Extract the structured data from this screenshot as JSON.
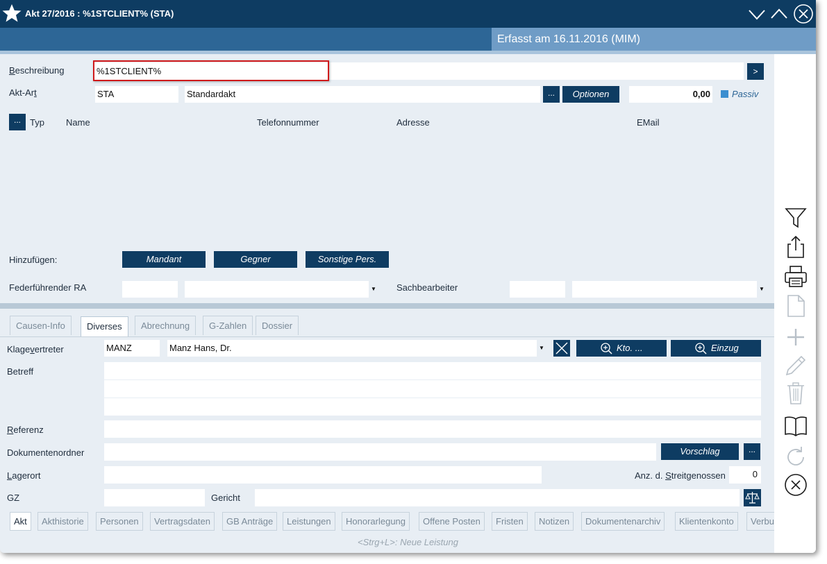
{
  "window": {
    "title": "Akt 27/2016 : %1STCLIENT% (STA)",
    "captured": "Erfasst am 16.11.2016 (MIM)"
  },
  "header_form": {
    "beschreibung_label": "Beschreibung",
    "beschreibung_value": "%1STCLIENT%",
    "expand_button": ">",
    "aktart_label": "Akt-Art",
    "aktart_code": "STA",
    "aktart_name": "Standardakt",
    "more_button": "...",
    "optionen_button": "Optionen",
    "amount": "0,00",
    "passiv_label": "Passiv"
  },
  "persons_table": {
    "menu_button": "...",
    "columns": [
      "Typ",
      "Name",
      "Telefonnummer",
      "Adresse",
      "EMail"
    ]
  },
  "add_row": {
    "label": "Hinzufügen:",
    "buttons": [
      "Mandant",
      "Gegner",
      "Sonstige Pers."
    ]
  },
  "responsible": {
    "ra_label": "Federführender RA",
    "sachbearbeiter_label": "Sachbearbeiter"
  },
  "tabs": [
    "Causen-Info",
    "Diverses",
    "Abrechnung",
    "G-Zahlen",
    "Dossier"
  ],
  "diverses": {
    "klagevertreter_label": "Klagevertreter",
    "klagevertreter_code": "MANZ",
    "klagevertreter_name": "Manz Hans, Dr.",
    "kto_button": "Kto. ...",
    "einzug_button": "Einzug",
    "betreff_label": "Betreff",
    "referenz_label": "Referenz",
    "dokumentenordner_label": "Dokumentenordner",
    "vorschlag_button": "Vorschlag",
    "dots_button": "...",
    "lagerort_label": "Lagerort",
    "streitgenossen_label": "Anz. d. Streitgenossen",
    "streitgenossen_value": "0",
    "gz_label": "GZ",
    "gericht_label": "Gericht"
  },
  "bottom_tabs": [
    "Akt",
    "Akthistorie",
    "Personen",
    "Vertragsdaten",
    "GB Anträge",
    "Leistungen",
    "Honorarlegung",
    "Offene Posten",
    "Fristen",
    "Notizen",
    "Dokumentenarchiv",
    "Klientenkonto",
    "Verbund"
  ],
  "status_hint": "<Strg+L>: Neue Leistung",
  "right_icons": [
    "filter-icon",
    "share-icon",
    "print-icon",
    "new-document-icon",
    "add-icon",
    "edit-icon",
    "delete-icon",
    "book-icon",
    "refresh-icon",
    "close-circle-icon"
  ],
  "colors": {
    "primary": "#0e3c62",
    "header_light": "#6f9cc6",
    "panel_bg": "#e8eef4",
    "highlight_border": "#d0191b",
    "passiv_swatch": "#3b8ed0"
  }
}
